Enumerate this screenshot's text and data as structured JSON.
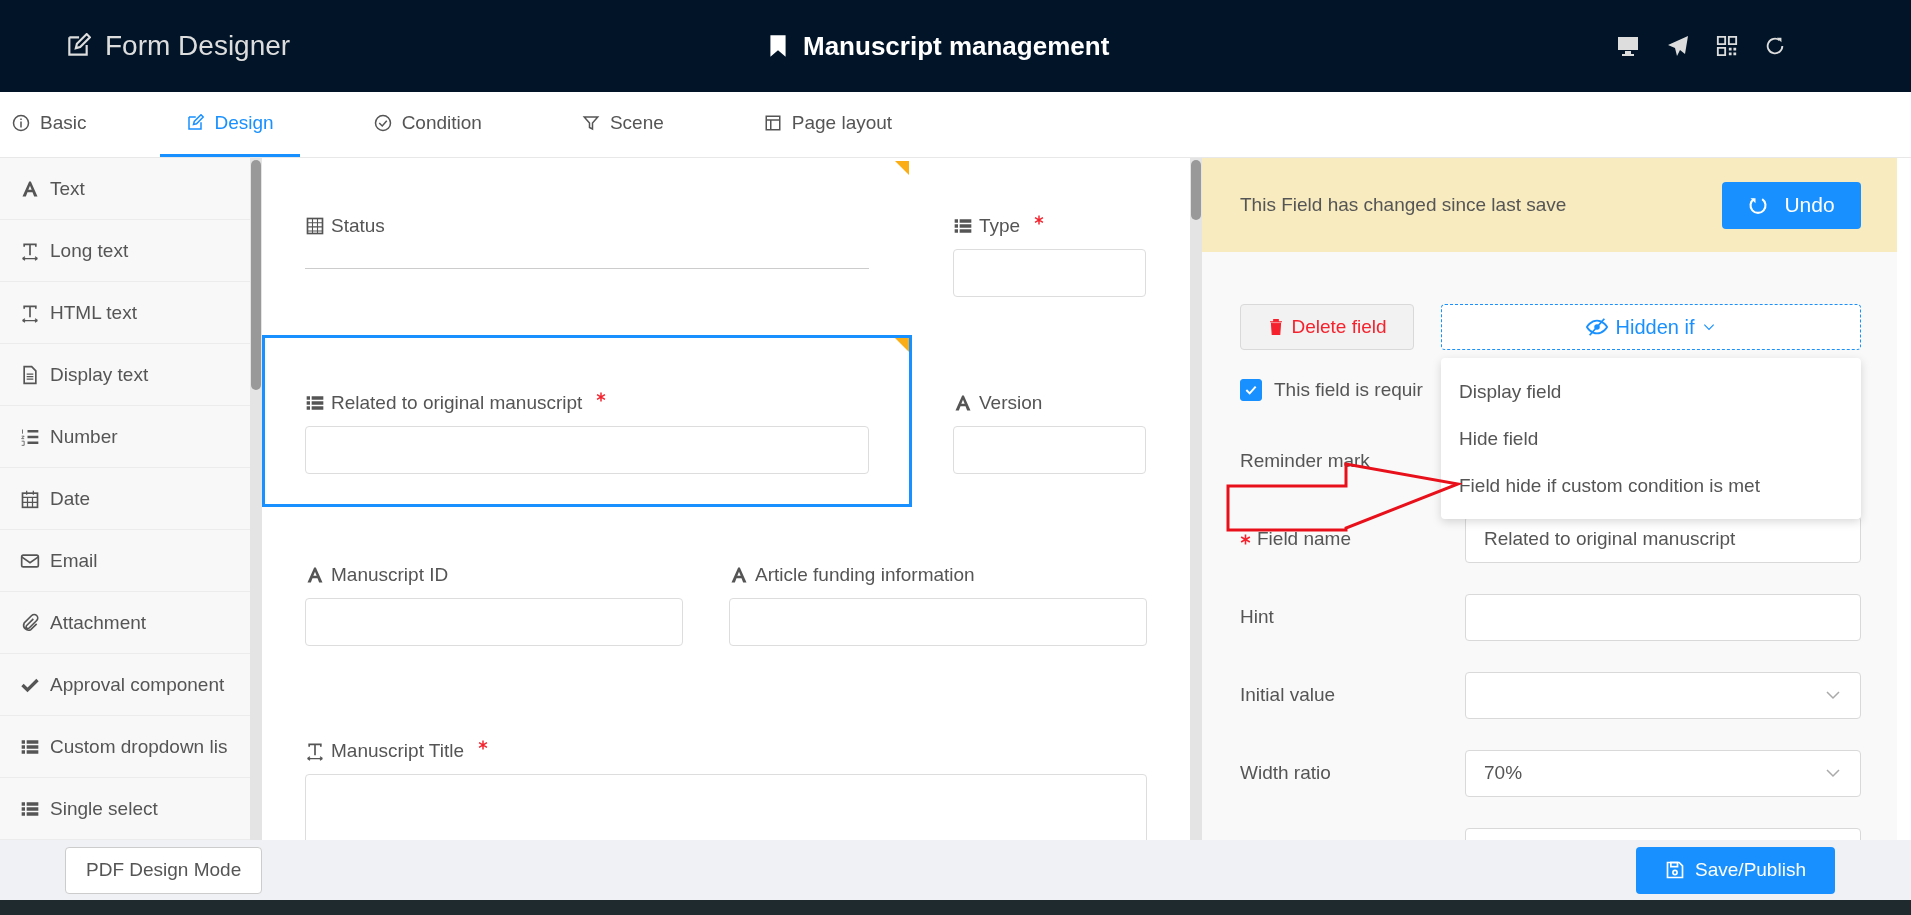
{
  "header": {
    "title": "Form Designer",
    "document_title": "Manuscript management"
  },
  "tabs": [
    {
      "label": "Basic",
      "selected": false
    },
    {
      "label": "Design",
      "selected": true
    },
    {
      "label": "Condition",
      "selected": false
    },
    {
      "label": "Scene",
      "selected": false
    },
    {
      "label": "Page layout",
      "selected": false
    }
  ],
  "sidebar": {
    "items": [
      {
        "label": "Text"
      },
      {
        "label": "Long text"
      },
      {
        "label": "HTML text"
      },
      {
        "label": "Display text"
      },
      {
        "label": "Number"
      },
      {
        "label": "Date"
      },
      {
        "label": "Email"
      },
      {
        "label": "Attachment"
      },
      {
        "label": "Approval component"
      },
      {
        "label": "Custom dropdown lis"
      },
      {
        "label": "Single select"
      }
    ]
  },
  "form": {
    "rows": [
      [
        {
          "label": "Status",
          "required": false,
          "kind": "line",
          "selected": false
        },
        {
          "label": "Type",
          "required": true,
          "kind": "input",
          "selected": false
        }
      ],
      [
        {
          "label": "Related to original manuscript",
          "required": true,
          "kind": "input",
          "selected": true
        },
        {
          "label": "Version",
          "required": false,
          "kind": "input",
          "selected": false
        }
      ],
      [
        {
          "label": "Manuscript ID",
          "required": false,
          "kind": "input",
          "selected": false
        },
        {
          "label": "Article funding information",
          "required": false,
          "kind": "input",
          "selected": false
        }
      ],
      [
        {
          "label": "Manuscript Title",
          "required": true,
          "kind": "textarea",
          "selected": false
        }
      ]
    ]
  },
  "properties": {
    "banner": {
      "text": "This Field has changed since last save",
      "button": "Undo"
    },
    "delete_button": "Delete field",
    "visibility_button": "Hidden if",
    "visibility_menu": [
      {
        "label": "Display field",
        "selected": false
      },
      {
        "label": "Hide field",
        "selected": false
      },
      {
        "label": "Field hide if custom condition is met",
        "selected": false
      }
    ],
    "required_checkbox": {
      "label": "This field is requir",
      "checked": true
    },
    "rows": [
      {
        "label": "Reminder mark",
        "kind": "none",
        "required": false
      },
      {
        "label": "Field name",
        "kind": "input",
        "required": true,
        "value": "Related to original manuscript"
      },
      {
        "label": "Hint",
        "kind": "input",
        "required": false
      },
      {
        "label": "Initial value",
        "kind": "select",
        "required": false
      },
      {
        "label": "Width ratio",
        "kind": "select",
        "required": false,
        "value": "70%"
      },
      {
        "kind": "input"
      }
    ]
  },
  "footer": {
    "left_button": "PDF Design Mode",
    "right_button": "Save/Publish"
  }
}
